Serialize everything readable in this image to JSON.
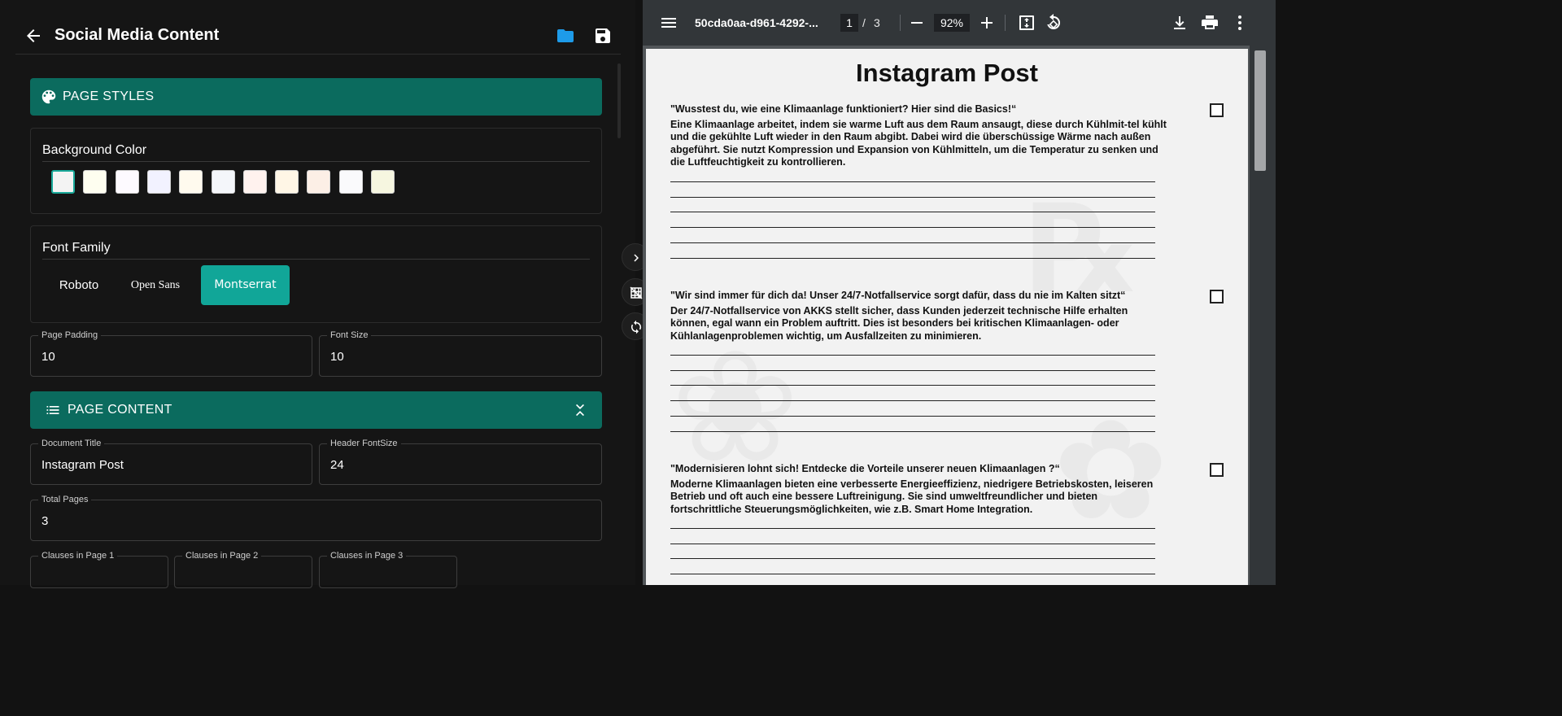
{
  "header": {
    "title": "Social Media Content"
  },
  "page_styles": {
    "heading": "PAGE STYLES",
    "background": {
      "label": "Background Color",
      "swatches": [
        "#f3f3f3",
        "#fefef0",
        "#fdfaff",
        "#f2f2ff",
        "#fffaee",
        "#f4f6fa",
        "#fff2ee",
        "#fff6e6",
        "#fcefe6",
        "#fafafc",
        "#f6f6e0"
      ]
    },
    "font_family": {
      "label": "Font Family",
      "options": [
        "Roboto",
        "Open Sans",
        "Montserrat"
      ],
      "selected": "Montserrat"
    },
    "page_padding": {
      "label": "Page Padding",
      "value": "10"
    },
    "font_size": {
      "label": "Font Size",
      "value": "10"
    }
  },
  "page_content": {
    "heading": "PAGE CONTENT",
    "document_title": {
      "label": "Document Title",
      "value": "Instagram Post"
    },
    "header_font_size": {
      "label": "Header FontSize",
      "value": "24"
    },
    "total_pages": {
      "label": "Total Pages",
      "value": "3"
    },
    "clauses": [
      {
        "label": "Clauses in Page 1"
      },
      {
        "label": "Clauses in Page 2"
      },
      {
        "label": "Clauses in Page 3"
      }
    ]
  },
  "viewer": {
    "file_name": "50cda0aa-d961-4292-...",
    "current_page": "1",
    "page_separator": "/",
    "total_pages": "3",
    "zoom": "92%"
  },
  "pdf": {
    "title": "Instagram Post",
    "items": [
      {
        "title": "\"Wusstest du, wie eine Klimaanlage funktioniert? Hier sind die Basics!“",
        "body": "Eine Klimaanlage arbeitet, indem sie warme Luft aus dem Raum ansaugt, diese durch Kühlmit-tel kühlt und die gekühlte Luft wieder in den Raum abgibt. Dabei wird die überschüssige Wärme nach außen abgeführt. Sie nutzt Kompression und Expansion von Kühlmitteln, um die Temperatur zu senken und die Luftfeuchtigkeit zu kontrollieren."
      },
      {
        "title": "\"Wir sind immer für dich da! Unser 24/7-Notfallservice sorgt dafür, dass du nie im Kalten sitzt“",
        "body": "Der 24/7-Notfallservice von AKKS stellt sicher, dass Kunden jederzeit technische Hilfe erhalten können, egal wann ein Problem auftritt. Dies ist besonders bei kritischen Klimaanlagen- oder Kühlanlagenproblemen wichtig, um Ausfallzeiten zu minimieren."
      },
      {
        "title": "\"Modernisieren lohnt sich! Entdecke die Vorteile unserer neuen Klimaanlagen ?“",
        "body": "Moderne Klimaanlagen bieten eine verbesserte Energieeffizienz, niedrigere Betriebskosten, leiseren Betrieb und oft auch eine bessere Luftreinigung. Sie sind umweltfreundlicher und bieten fortschrittliche Steuerungsmöglichkeiten, wie z.B. Smart Home Integration."
      }
    ]
  },
  "colors": {
    "accent": "#0b6b5e",
    "accent_bright": "#11a698",
    "folder_icon": "#1e9be9"
  },
  "icons": [
    "arrow-back-icon",
    "folder-icon",
    "save-icon",
    "palette-icon",
    "list-icon",
    "collapse-icon",
    "chevron-right-icon",
    "grid-off-icon",
    "sync-icon",
    "menu-icon",
    "zoom-out-icon",
    "zoom-in-icon",
    "fit-page-icon",
    "rotate-icon",
    "download-icon",
    "print-icon",
    "more-vert-icon"
  ]
}
